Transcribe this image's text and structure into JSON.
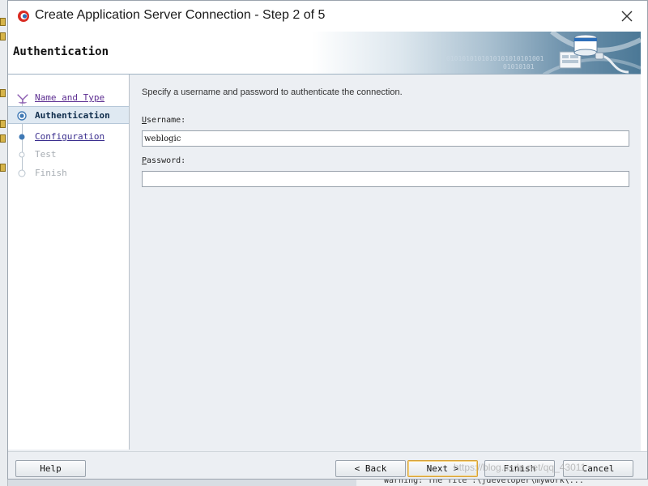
{
  "dialog": {
    "title": "Create Application Server Connection - Step 2 of 5",
    "header_title": "Authentication",
    "banner_binary_1": "0101010101010101010101001",
    "banner_binary_2": "01010101"
  },
  "steps": [
    {
      "label": "Name and Type",
      "state": "visited"
    },
    {
      "label": "Authentication",
      "state": "current"
    },
    {
      "label": "Configuration",
      "state": "link"
    },
    {
      "label": "Test",
      "state": "disabled"
    },
    {
      "label": "Finish",
      "state": "disabled"
    }
  ],
  "form": {
    "instruction": "Specify a username and password to authenticate the connection.",
    "username_label_mnemonic": "U",
    "username_label_rest": "sername:",
    "username_value": "weblogic",
    "password_label_mnemonic": "P",
    "password_label_rest": "assword:",
    "password_value": ""
  },
  "buttons": {
    "help": "Help",
    "back": "< Back",
    "next": "Next >",
    "finish": "Finish",
    "cancel": "Cancel"
  },
  "background": {
    "status_text": "Warning: The file :\\jdeveloper\\mywork\\...",
    "watermark": "https://blog.csdn.net/qq_43011"
  },
  "colors": {
    "accent": "#3a2e8e",
    "current_step_bg": "#dfe9f2",
    "primary_button_border": "#d6a23a"
  },
  "icons": {
    "app": "jdeveloper-icon",
    "close": "close-icon",
    "banner": "server-connection-icon"
  }
}
